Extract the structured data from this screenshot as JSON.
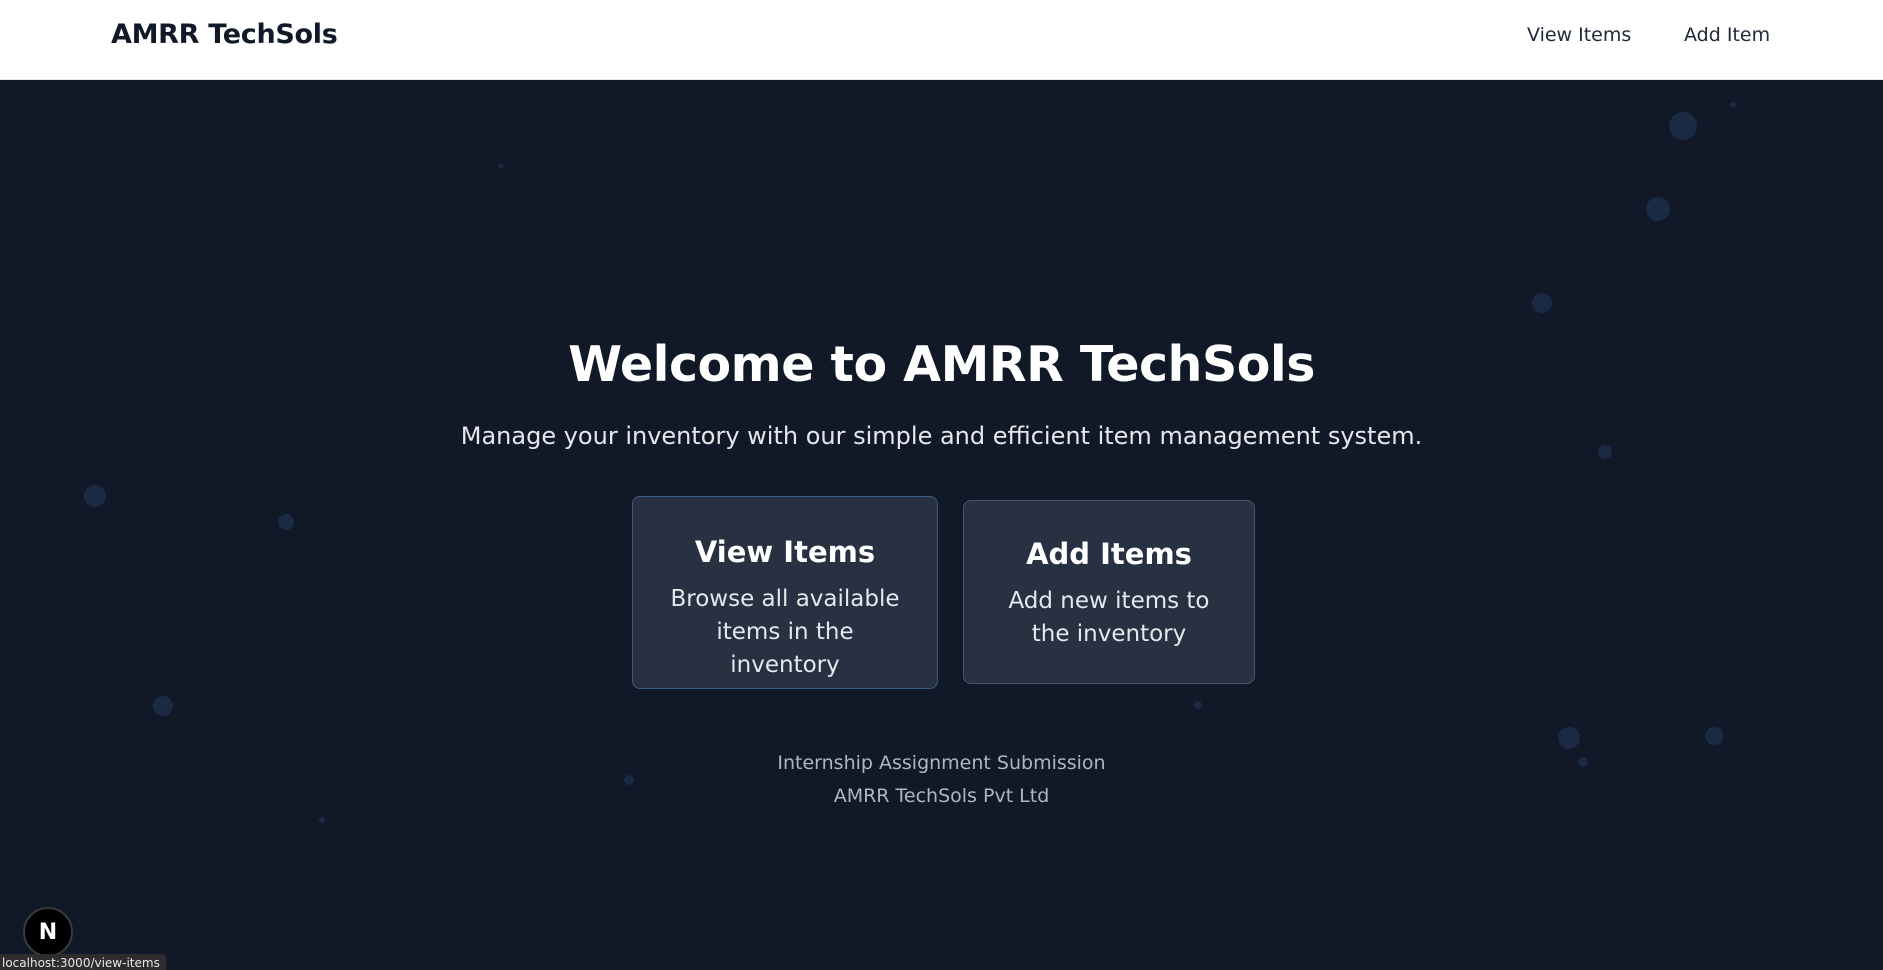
{
  "navbar": {
    "brand": "AMRR TechSols",
    "links": [
      {
        "label": "View Items"
      },
      {
        "label": "Add Item"
      }
    ]
  },
  "hero": {
    "title": "Welcome to AMRR TechSols",
    "subtitle": "Manage your inventory with our simple and efficient item management system."
  },
  "cards": [
    {
      "title": "View Items",
      "description": "Browse all available items in the inventory"
    },
    {
      "title": "Add Items",
      "description": "Add new items to the inventory"
    }
  ],
  "footer": {
    "line1": "Internship Assignment Submission",
    "line2": "AMRR TechSols Pvt Ltd"
  },
  "dev_badge": {
    "letter": "N"
  },
  "status_bar": {
    "url": "localhost:3000/view-items"
  },
  "colors": {
    "background": "#111827",
    "navbar": "#ffffff",
    "card": "#273142",
    "card_border_active": "#3b5a87"
  }
}
